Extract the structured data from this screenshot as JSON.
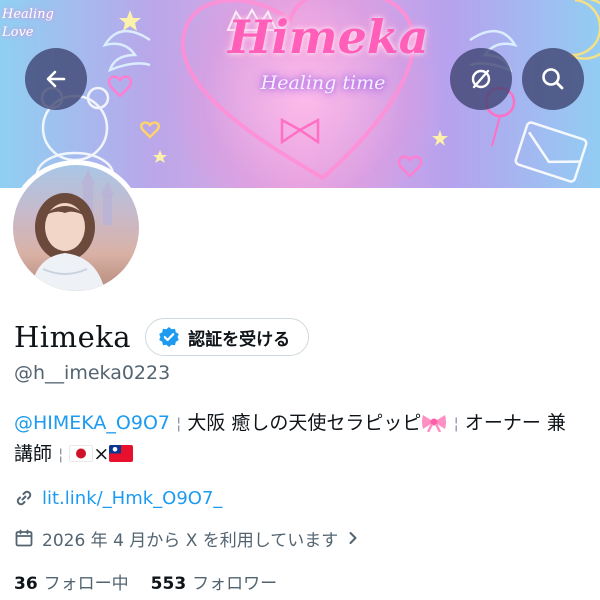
{
  "banner": {
    "title": "Himeka",
    "subtitle": "Healing time",
    "corner_text_1": "Healing",
    "corner_text_2": "Love"
  },
  "nav": {
    "back_icon": "arrow-left-icon",
    "hidden_icon": "eye-slash-icon",
    "search_icon": "search-icon"
  },
  "profile": {
    "display_name": "Himeka",
    "verify_label": "認証を受ける",
    "handle": "@h__imeka0223",
    "bio": {
      "mention": "@HIMEKA_O9O7",
      "text_1": "大阪 癒しの天使セラピッピ",
      "ribbon_icon": "ribbon-emoji",
      "text_2": "オーナー 兼 講師",
      "flag_1": "flag-japan",
      "times": "×",
      "flag_2": "flag-taiwan"
    },
    "link": "lit.link/_Hmk_O9O7_",
    "joined": "2026 年 4 月から X を利用しています"
  },
  "stats": {
    "following_count": "36",
    "following_label": "フォロー中",
    "followers_count": "553",
    "followers_label": "フォロワー"
  },
  "colors": {
    "accent": "#1d9bf0",
    "secondary_text": "#536471",
    "primary_text": "#0f1419",
    "button_bg": "#3c416e"
  }
}
